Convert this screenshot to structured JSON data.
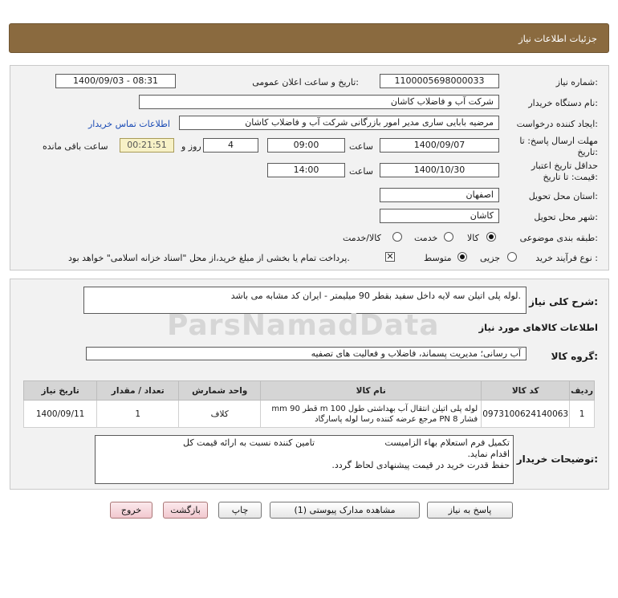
{
  "header": {
    "title": "جزئیات اطلاعات نیاز"
  },
  "form": {
    "need_number_label": "شماره نیاز:",
    "need_number": "1100005698000033",
    "announce_label": "تاریخ و ساعت اعلان عمومی:",
    "announce_value": "1400/09/03 - 08:31",
    "buyer_org_label": "نام دستگاه خریدار:",
    "buyer_org": "شرکت آب و فاضلاب کاشان",
    "requester_label": "ایجاد کننده درخواست:",
    "requester": "مرضیه بابایی ساری مدیر امور بازرگانی شرکت آب و فاضلاب کاشان",
    "contact_link": "اطلاعات تماس خریدار",
    "send_deadline_label_1": "مهلت ارسال پاسخ: تا",
    "send_deadline_label_2": "تاریخ:",
    "send_date": "1400/09/07",
    "time_label": "ساعت",
    "send_time": "09:00",
    "days_value": "4",
    "days_label": "روز و",
    "remaining_time": "00:21:51",
    "remaining_label": "ساعت باقی مانده",
    "validity_label_1": "حداقل تاریخ اعتبار",
    "validity_label_2": "قیمت: تا تاریخ:",
    "validity_date": "1400/10/30",
    "validity_time_label": "ساعت",
    "validity_time": "14:00",
    "province_label": "استان محل تحویل:",
    "province": "اصفهان",
    "city_label": "شهر محل تحویل:",
    "city": "کاشان",
    "category_label": "طبقه بندی موضوعی:",
    "category_options": [
      "کالا",
      "خدمت",
      "کالا/خدمت"
    ],
    "process_label": "نوع فرآیند خرید :",
    "process_options": [
      "جزیی",
      "متوسط"
    ],
    "treasury_note": "پرداخت تمام یا بخشی از مبلغ خرید،از محل \"اسناد خزانه اسلامی\" خواهد بود."
  },
  "summary": {
    "label": "شرح کلی نیاز:",
    "text": "لوله پلی اتیلن سه لایه داخل سفید بقطر 90 میلیمتر                    - ایران کد مشابه می باشد."
  },
  "goods_section_title": "اطلاعات کالاهای مورد نیاز",
  "goods_group": {
    "label": "گروه کالا:",
    "value": "آب رسانی؛ مدیریت پسماند، فاضلاب و فعالیت های تصفیه"
  },
  "table": {
    "headers": [
      "ردیف",
      "کد کالا",
      "نام کالا",
      "واحد شمارش",
      "تعداد / مقدار",
      "تاریخ نیاز"
    ],
    "rows": [
      {
        "row": "1",
        "code": "0973100624140063",
        "name": "لوله پلی اتیلن انتقال آب بهداشتی طول 100 m قطر 90 mm فشار 8 PN مرجع عرضه کننده رسا لوله پاسارگاد",
        "unit": "کلاف",
        "qty": "1",
        "date": "1400/09/11"
      }
    ]
  },
  "buyer_notes": {
    "label": "توضیحات خریدار:",
    "line1": "تکمیل فرم استعلام بهاء الزامیست                         تامین کننده نسبت به ارائه قیمت کل",
    "line2": "اقدام نماید.",
    "line3": "حفظ قدرت خرید در قیمت پیشنهادی لحاظ گردد."
  },
  "buttons": {
    "reply": "پاسخ به نیاز",
    "attachments": "مشاهده مدارک پیوستی (1)",
    "print": "چاپ",
    "back": "بازگشت",
    "exit": "خروج"
  },
  "watermark": {
    "brand": "ParsNamadData"
  },
  "colors": {
    "header": "#8a6a3f",
    "panel": "#f2f2f2",
    "link": "#1a4bb5",
    "remaining_bg": "#f7f1c6"
  }
}
